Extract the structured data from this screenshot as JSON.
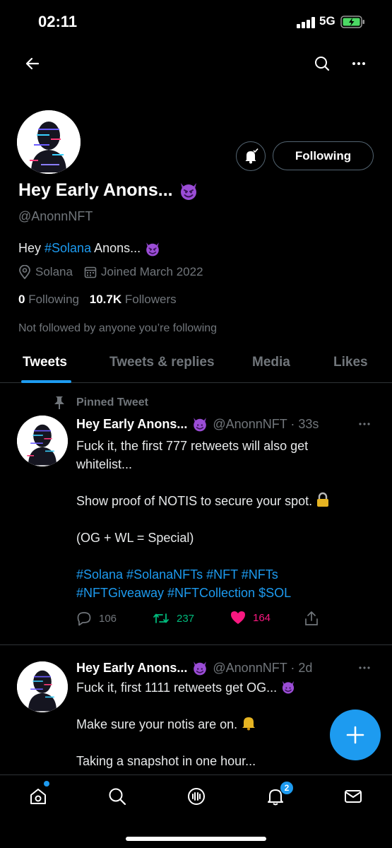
{
  "status": {
    "time": "02:11",
    "network": "5G"
  },
  "profile": {
    "name": "Hey Early Anons...",
    "handle": "@AnonnNFT",
    "bio_prefix": "Hey ",
    "bio_hashtag": "#Solana",
    "bio_suffix": " Anons...",
    "location": "Solana",
    "joined": "Joined March 2022",
    "following_count": "0",
    "following_label": "Following",
    "followers_count": "10.7K",
    "followers_label": "Followers",
    "not_followed": "Not followed by anyone you’re following",
    "follow_button": "Following"
  },
  "tabs": [
    {
      "label": "Tweets"
    },
    {
      "label": "Tweets & replies"
    },
    {
      "label": "Media"
    },
    {
      "label": "Likes"
    }
  ],
  "pinned_label": "Pinned Tweet",
  "tweets": [
    {
      "name": "Hey Early Anons...",
      "handle": "@AnonnNFT · 33s",
      "line1": "Fuck it, the first 777 retweets will also get",
      "line2": "whitelist...",
      "line3": "Show proof of NOTIS to secure your spot.",
      "line4": "(OG + WL = Special)",
      "tags1": "#Solana #SolanaNFTs #NFT #NFTs",
      "tags2": "#NFTGiveaway #NFTCollection $SOL",
      "replies": "106",
      "retweets": "237",
      "likes": "164"
    },
    {
      "name": "Hey Early Anons...",
      "handle": "@AnonnNFT · 2d",
      "line1": "Fuck it, first 1111 retweets get OG...",
      "line2": "Make sure your notis are on.",
      "line3": "Taking a snapshot in one hour..."
    }
  ],
  "nav": {
    "notifications_badge": "2"
  },
  "colors": {
    "accent": "#1d9bf0",
    "retweet": "#00ba7c",
    "like": "#f91880",
    "muted": "#71767b"
  },
  "icons": [
    "back-arrow-icon",
    "search-icon",
    "more-icon",
    "bell-icon",
    "location-icon",
    "calendar-icon",
    "pin-icon",
    "reply-icon",
    "retweet-icon",
    "heart-icon",
    "share-icon",
    "compose-icon",
    "home-icon",
    "explore-icon",
    "spaces-icon",
    "notifications-icon",
    "messages-icon",
    "devil-emoji-icon",
    "lock-emoji-icon"
  ]
}
